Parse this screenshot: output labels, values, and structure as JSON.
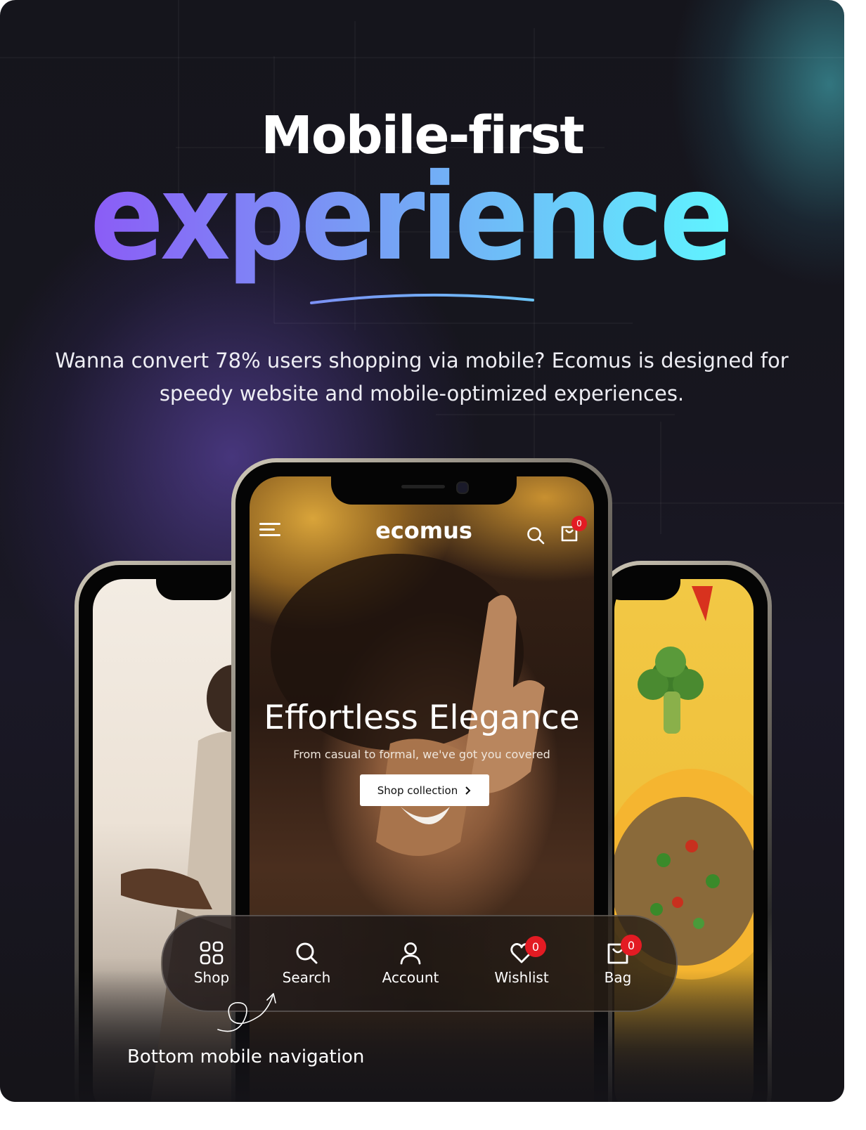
{
  "headline": {
    "line1": "Mobile-first",
    "line2": "experience",
    "description": "Wanna convert 78% users shopping via mobile? Ecomus is designed for speedy website and mobile-optimized experiences."
  },
  "phone_app": {
    "brand": "ecomus",
    "cart_count": "0",
    "hero_title": "Effortless Elegance",
    "hero_subtitle": "From casual to formal, we've got you covered",
    "cta_label": "Shop collection"
  },
  "bottom_nav": {
    "items": [
      {
        "label": "Shop",
        "icon": "grid-icon"
      },
      {
        "label": "Search",
        "icon": "search-icon"
      },
      {
        "label": "Account",
        "icon": "user-icon"
      },
      {
        "label": "Wishlist",
        "icon": "heart-icon",
        "badge": "0"
      },
      {
        "label": "Bag",
        "icon": "bag-icon",
        "badge": "0"
      }
    ]
  },
  "caption": "Bottom mobile navigation",
  "colors": {
    "gradient_start": "#8b5cf6",
    "gradient_mid": "#74a8f5",
    "gradient_end": "#5ff5ff",
    "badge": "#e31b23"
  }
}
